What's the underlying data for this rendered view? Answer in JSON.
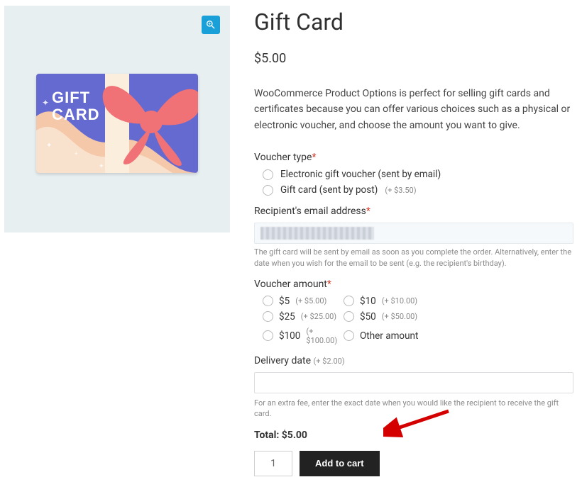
{
  "product": {
    "title": "Gift Card",
    "price": "$5.00",
    "description": "WooCommerce Product Options is perfect for selling gift cards and certificates because you can offer various choices such as a physical or electronic voucher, and choose the amount you want to give.",
    "image_text_line1": "GIFT",
    "image_text_line2": "CARD"
  },
  "voucher_type": {
    "label": "Voucher type",
    "required": "*",
    "options": [
      {
        "label": "Electronic gift voucher (sent by email)",
        "surcharge": ""
      },
      {
        "label": "Gift card (sent by post)",
        "surcharge": "(+ $3.50)"
      }
    ]
  },
  "recipient_email": {
    "label": "Recipient's email address",
    "required": "*",
    "helper": "The gift card will be sent by email as soon as you complete the order. Alternatively, enter the date when you wish for the email to be sent (e.g. the recipient's birthday)."
  },
  "voucher_amount": {
    "label": "Voucher amount",
    "required": "*",
    "options": [
      {
        "label": "$5",
        "surcharge": "(+ $5.00)"
      },
      {
        "label": "$10",
        "surcharge": "(+ $10.00)"
      },
      {
        "label": "$25",
        "surcharge": "(+ $25.00)"
      },
      {
        "label": "$50",
        "surcharge": "(+ $50.00)"
      },
      {
        "label": "$100",
        "surcharge": "(+ $100.00)"
      },
      {
        "label": "Other amount",
        "surcharge": ""
      }
    ]
  },
  "delivery_date": {
    "label": "Delivery date",
    "surcharge": "(+ $2.00)",
    "helper": "For an extra fee, enter the exact date when you would like the recipient to receive the gift card."
  },
  "total": {
    "label": "Total:",
    "value": "$5.00"
  },
  "actions": {
    "qty": "1",
    "add_to_cart": "Add to cart"
  }
}
